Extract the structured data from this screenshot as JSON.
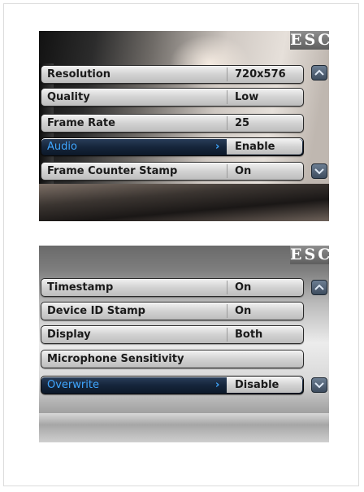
{
  "escape_label": "ESC",
  "panels": [
    {
      "rows": [
        {
          "label": "Resolution",
          "value": "720x576"
        },
        {
          "label": "Quality",
          "value": "Low"
        },
        {
          "label": "Frame Rate",
          "value": "25"
        },
        {
          "label": "Audio",
          "value": "Enable",
          "selected": true
        },
        {
          "label": "Frame Counter Stamp",
          "value": "On"
        }
      ]
    },
    {
      "rows": [
        {
          "label": "Timestamp",
          "value": "On"
        },
        {
          "label": "Device ID Stamp",
          "value": "On"
        },
        {
          "label": "Display",
          "value": "Both"
        },
        {
          "label": "Microphone Sensitivity",
          "value": ""
        },
        {
          "label": "Overwrite",
          "value": "Disable",
          "selected": true
        }
      ]
    }
  ],
  "icons": {
    "escape": "esc-button",
    "scroll_up": "chevron-up-icon",
    "scroll_down": "chevron-down-icon",
    "selection": "chevron-right-icon"
  },
  "colors": {
    "selected_text": "#3fa6ff",
    "selected_row": "#16263c",
    "scroll_button": "#4a5a6c"
  }
}
